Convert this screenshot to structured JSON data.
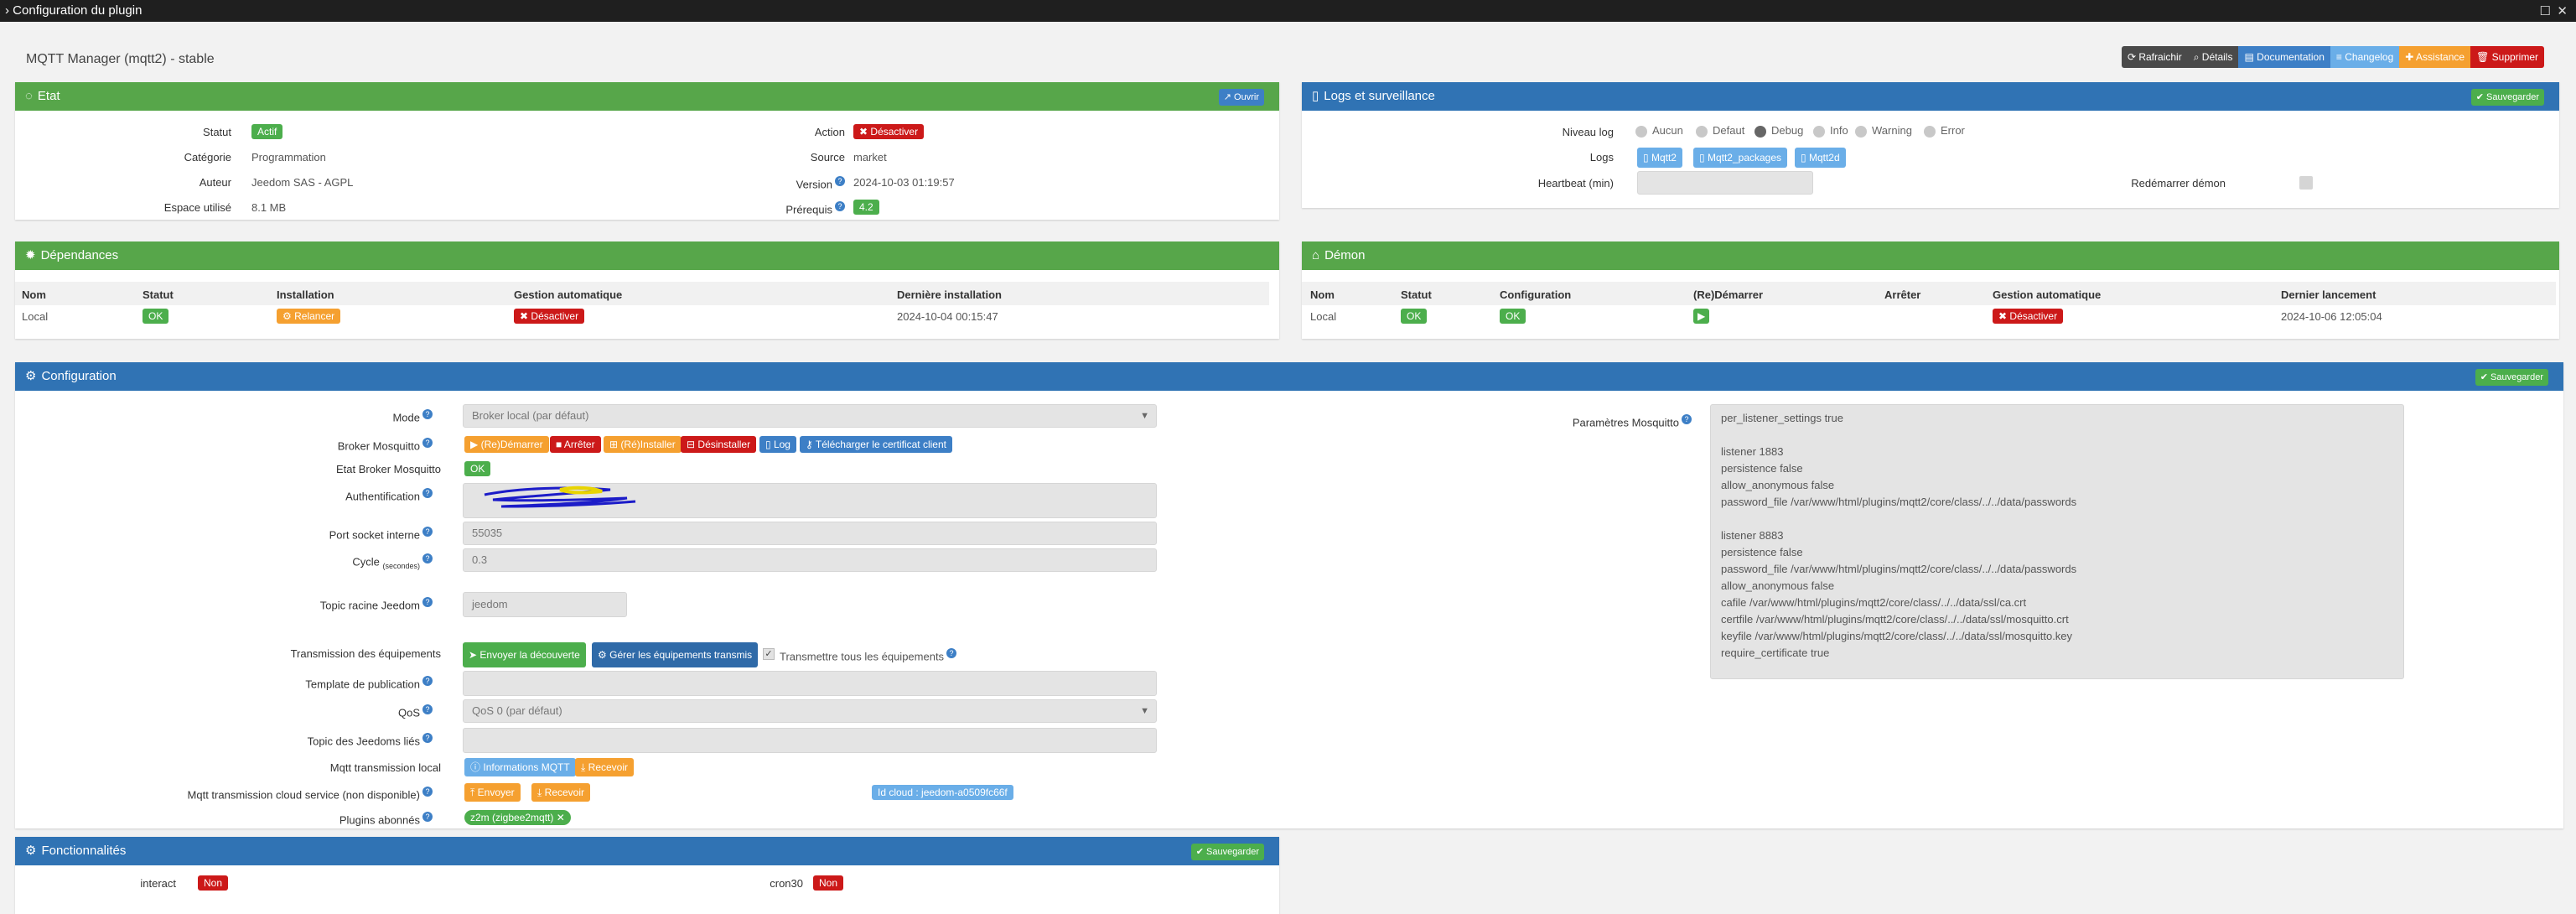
{
  "window": {
    "title": "Configuration du plugin"
  },
  "header": {
    "plugin_title": "MQTT Manager (mqtt2) - stable"
  },
  "toolbar": {
    "buttons": [
      {
        "label": "Rafraichir",
        "icon": "refresh-icon",
        "color": "#4a4a4a"
      },
      {
        "label": "Détails",
        "icon": "search-icon",
        "color": "#4a4a4a"
      },
      {
        "label": "Documentation",
        "icon": "book-icon",
        "color": "#3d7fc6"
      },
      {
        "label": "Changelog",
        "icon": "list-icon",
        "color": "#6aaee8"
      },
      {
        "label": "Assistance",
        "icon": "support-icon",
        "color": "#f5a030"
      },
      {
        "label": "Supprimer",
        "icon": "trash-icon",
        "color": "#cc1919"
      }
    ]
  },
  "etat": {
    "title": "Etat",
    "open_label": "Ouvrir",
    "statut_label": "Statut",
    "statut_value": "Actif",
    "categorie_label": "Catégorie",
    "categorie_value": "Programmation",
    "auteur_label": "Auteur",
    "auteur_value": "Jeedom SAS - AGPL",
    "espace_label": "Espace utilisé",
    "espace_value": "8.1 MB",
    "action_label": "Action",
    "action_value": "Désactiver",
    "source_label": "Source",
    "source_value": "market",
    "version_label": "Version",
    "version_value": "2024-10-03 01:19:57",
    "prerequis_label": "Prérequis",
    "prerequis_value": "4.2"
  },
  "logs": {
    "title": "Logs et surveillance",
    "save_label": "Sauvegarder",
    "niveau_label": "Niveau log",
    "levels": [
      "Aucun",
      "Defaut",
      "Debug",
      "Info",
      "Warning",
      "Error"
    ],
    "selected_level": "Debug",
    "logs_label": "Logs",
    "log_buttons": [
      "Mqtt2",
      "Mqtt2_packages",
      "Mqtt2d"
    ],
    "heartbeat_label": "Heartbeat (min)",
    "restart_label": "Redémarrer démon"
  },
  "dependances": {
    "title": "Dépendances",
    "headers": [
      "Nom",
      "Statut",
      "Installation",
      "Gestion automatique",
      "Dernière installation"
    ],
    "row": {
      "nom": "Local",
      "statut": "OK",
      "installation": "Relancer",
      "gestion": "Désactiver",
      "derniere": "2024-10-04 00:15:47"
    }
  },
  "demon": {
    "title": "Démon",
    "headers": [
      "Nom",
      "Statut",
      "Configuration",
      "(Re)Démarrer",
      "Arrêter",
      "Gestion automatique",
      "Dernier lancement"
    ],
    "row": {
      "nom": "Local",
      "statut": "OK",
      "configuration": "OK",
      "gestion": "Désactiver",
      "dernier": "2024-10-06 12:05:04"
    }
  },
  "configuration": {
    "title": "Configuration",
    "save_label": "Sauvegarder",
    "mode_label": "Mode",
    "mode_value": "Broker local (par défaut)",
    "broker_label": "Broker Mosquitto",
    "broker_buttons": [
      {
        "label": "(Re)Démarrer",
        "color": "#f5a030"
      },
      {
        "label": "Arrêter",
        "color": "#cc1919"
      },
      {
        "label": "(Ré)Installer",
        "color": "#f5a030"
      },
      {
        "label": "Désinstaller",
        "color": "#cc1919"
      },
      {
        "label": "Log",
        "color": "#3d7fc6"
      },
      {
        "label": "Télécharger le certificat client",
        "color": "#3d7fc6"
      }
    ],
    "etat_broker_label": "Etat Broker Mosquitto",
    "etat_broker_value": "OK",
    "auth_label": "Authentification",
    "port_label": "Port socket interne",
    "port_value": "55035",
    "cycle_label": "Cycle",
    "cycle_unit": "(secondes)",
    "cycle_value": "0.3",
    "topic_label": "Topic racine Jeedom",
    "topic_value": "jeedom",
    "transmission_label": "Transmission des équipements",
    "send_discovery": "Envoyer la découverte",
    "manage_equip": "Gérer les équipements transmis",
    "transmit_all": "Transmettre tous les équipements",
    "template_label": "Template de publication",
    "qos_label": "QoS",
    "qos_value": "QoS 0 (par défaut)",
    "linked_label": "Topic des Jeedoms liés",
    "local_label": "Mqtt transmission local",
    "local_info": "Informations MQTT",
    "local_recv": "Recevoir",
    "cloud_label": "Mqtt transmission cloud service (non disponible)",
    "cloud_send": "Envoyer",
    "cloud_recv": "Recevoir",
    "cloud_id": "Id cloud : jeedom-a0509fc66f",
    "plugins_label": "Plugins abonnés",
    "plugins_value": "z2m (zigbee2mqtt)",
    "params_label": "Paramètres Mosquitto",
    "params_lines": [
      "per_listener_settings true",
      "",
      "listener 1883",
      "persistence false",
      "allow_anonymous false",
      "password_file /var/www/html/plugins/mqtt2/core/class/../../data/passwords",
      "",
      "listener 8883",
      "persistence false",
      "password_file /var/www/html/plugins/mqtt2/core/class/../../data/passwords",
      "allow_anonymous false",
      "cafile /var/www/html/plugins/mqtt2/core/class/../../data/ssl/ca.crt",
      "certfile /var/www/html/plugins/mqtt2/core/class/../../data/ssl/mosquitto.crt",
      "keyfile /var/www/html/plugins/mqtt2/core/class/../../data/ssl/mosquitto.key",
      "require_certificate true"
    ]
  },
  "fonctionnalites": {
    "title": "Fonctionnalités",
    "save_label": "Sauvegarder",
    "items": [
      {
        "label": "interact",
        "value": "Non"
      },
      {
        "label": "cron30",
        "value": "Non"
      }
    ]
  }
}
